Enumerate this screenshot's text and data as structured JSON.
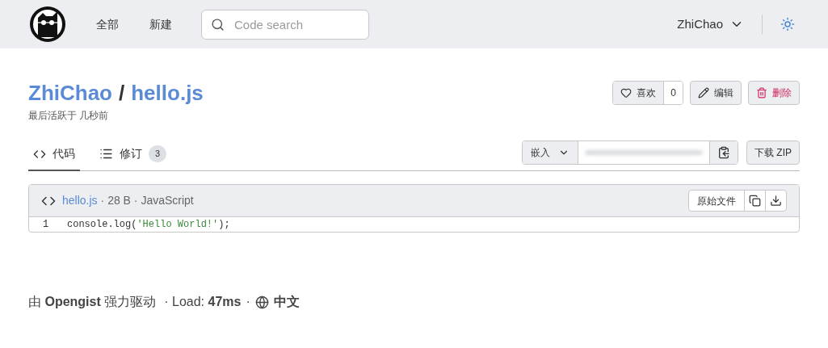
{
  "nav": {
    "links": [
      "全部",
      "新建"
    ],
    "search": {
      "placeholder": "Code search"
    },
    "user": "ZhiChao"
  },
  "gist": {
    "owner": "ZhiChao",
    "separator": "/",
    "name": "hello.js",
    "activity": "最后活跃于 几秒前"
  },
  "actions": {
    "like": {
      "label": "喜欢",
      "count": "0"
    },
    "edit": "编辑",
    "delete": "删除"
  },
  "tabs": [
    {
      "label": "代码",
      "selected": true,
      "kind": "code"
    },
    {
      "label": "修订",
      "selected": false,
      "kind": "revisions",
      "count": "3"
    }
  ],
  "embed": {
    "label": "嵌入",
    "download": "下载 ZIP"
  },
  "file": {
    "name": "hello.js",
    "meta": "· 28 B · JavaScript",
    "raw": "原始文件",
    "lines": [
      {
        "number": "1",
        "tokens": [
          {
            "kind": "plain",
            "text": "console.log("
          },
          {
            "kind": "string",
            "text": "'Hello World!'"
          },
          {
            "kind": "plain",
            "text": ");"
          }
        ]
      }
    ]
  },
  "footer": {
    "prefix": "由",
    "brand": "Opengist",
    "suffix": "强力驱动",
    "load_label": "· Load:",
    "load_value": "47ms",
    "dot": "·",
    "language": "中文"
  }
}
